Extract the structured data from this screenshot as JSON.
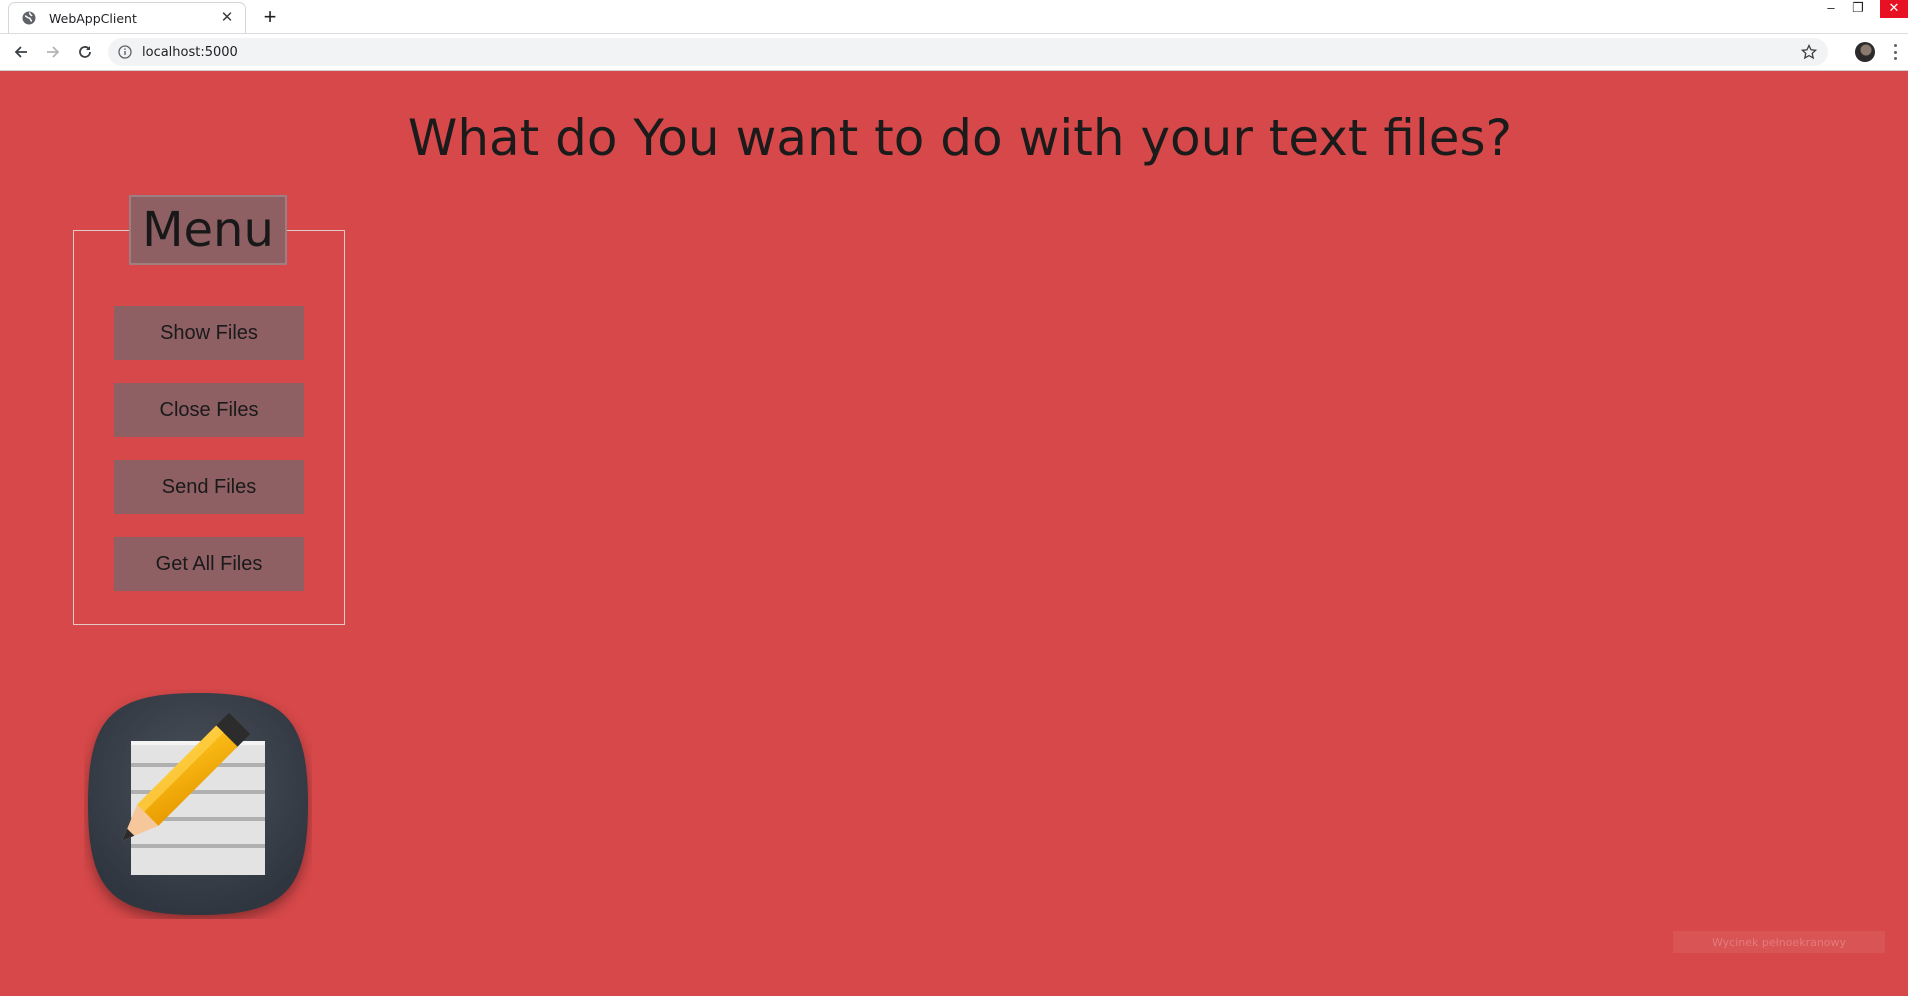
{
  "browser": {
    "tab_title": "WebAppClient",
    "url": "localhost:5000"
  },
  "page": {
    "heading": "What do You want to do with your text files?",
    "menu": {
      "legend": "Menu",
      "buttons": [
        "Show Files",
        "Close Files",
        "Send Files",
        "Get All Files"
      ]
    },
    "overlay_text": "Wycinek pełnoekranowy"
  },
  "colors": {
    "background": "#d64849",
    "button": "#8e5f63",
    "heading_text": "#1b1b1b"
  },
  "icons": [
    "globe-icon",
    "close-icon",
    "plus-icon",
    "back-arrow-icon",
    "forward-arrow-icon",
    "reload-icon",
    "info-icon",
    "star-icon",
    "notepad-pencil-icon"
  ]
}
